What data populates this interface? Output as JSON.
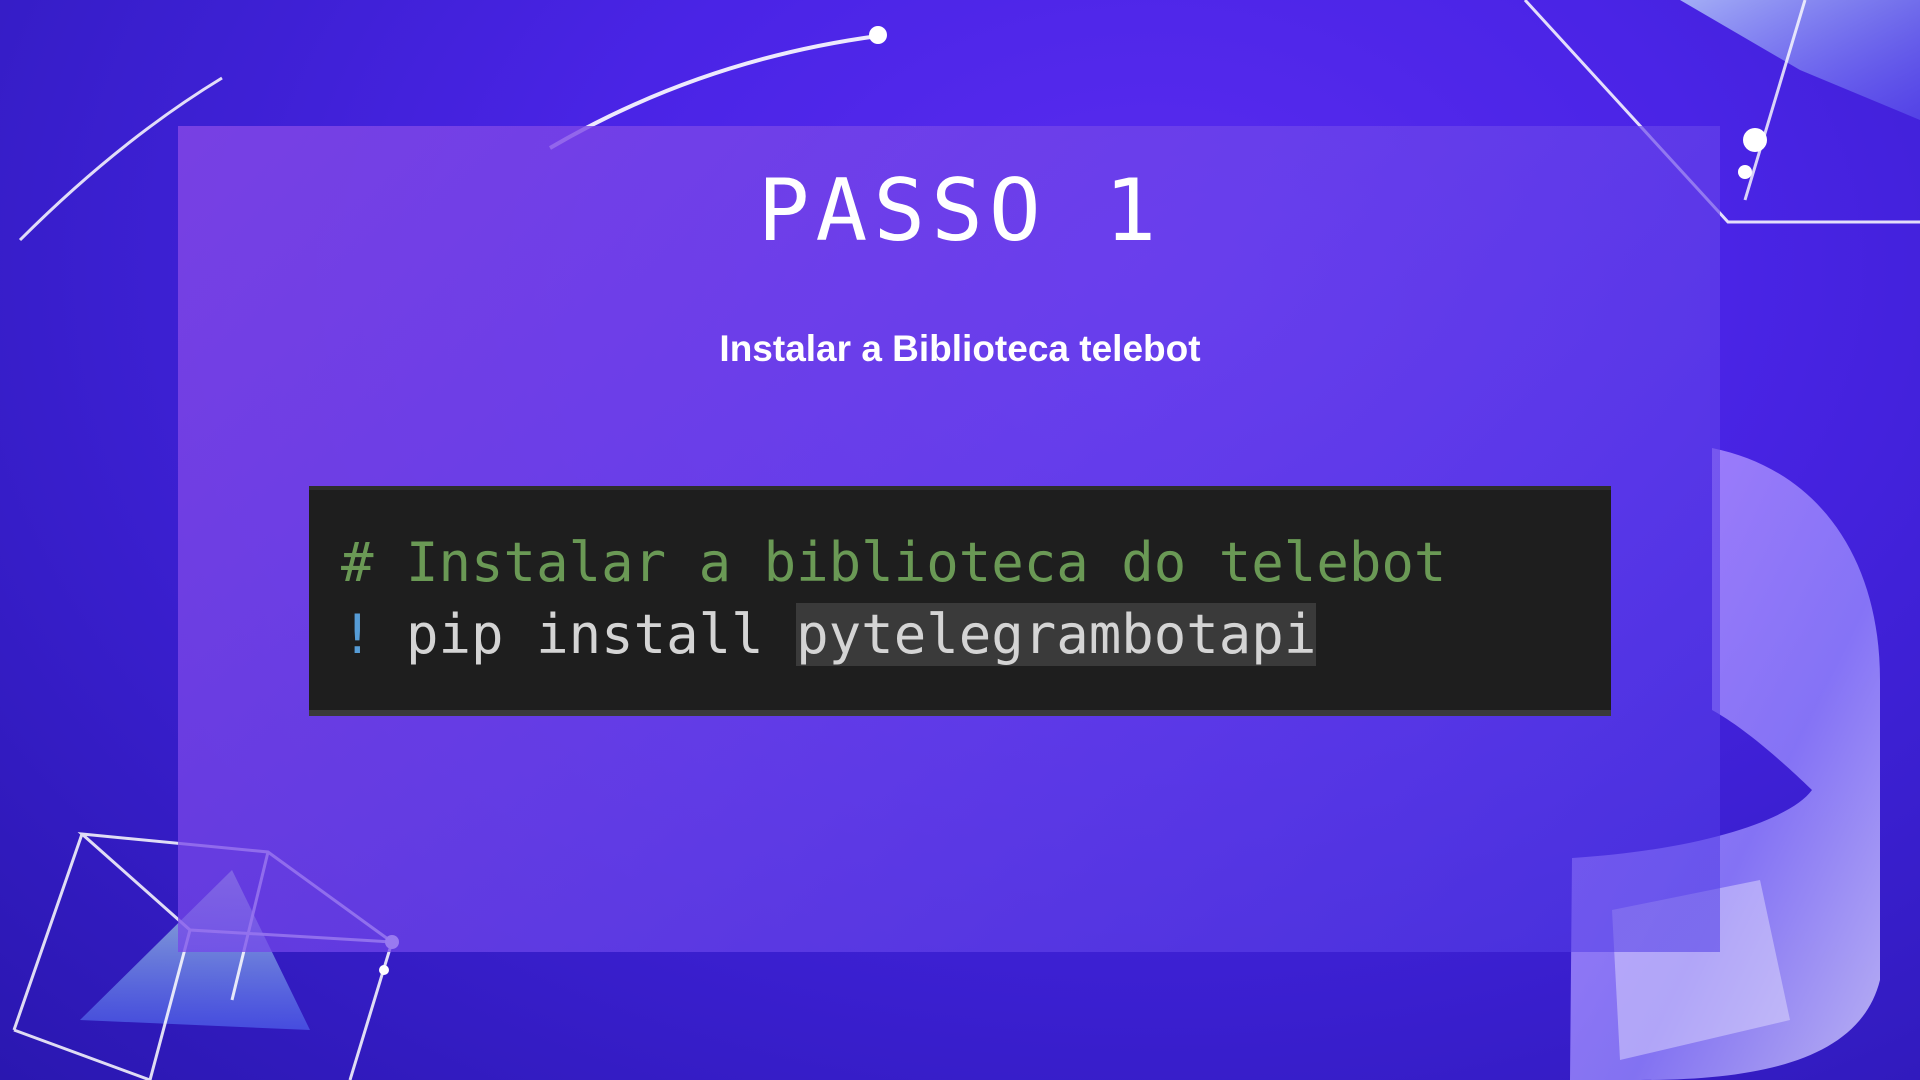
{
  "slide": {
    "title": "PASSO 1",
    "subtitle": "Instalar a Biblioteca telebot"
  },
  "code": {
    "comment": "# Instalar a biblioteca do telebot",
    "bang": "!",
    "command": " pip install ",
    "package": "pytelegrambotapi"
  },
  "colors": {
    "background": "#4a24e6",
    "panel": "#7a48e0",
    "code_background": "#1e1e1e",
    "comment": "#6a9955",
    "bang": "#569cd6",
    "text": "#d4d4d4"
  }
}
